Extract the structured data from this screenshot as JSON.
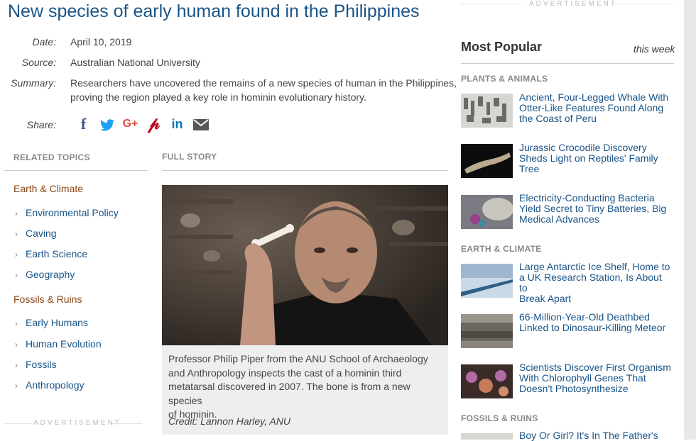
{
  "article": {
    "title": "New species of early human found in the Philippines",
    "date_label": "Date:",
    "date": "April 10, 2019",
    "source_label": "Source:",
    "source": "Australian National University",
    "summary_label": "Summary:",
    "summary_line1": "Researchers have uncovered the remains of a new species of human in the Philippines,",
    "summary_line2": "proving the region played a key role in hominin evolutionary history.",
    "share_label": "Share:",
    "share_icons": [
      "facebook-icon",
      "twitter-icon",
      "google-plus-icon",
      "pinterest-icon",
      "linkedin-icon",
      "email-icon"
    ],
    "full_story": "FULL STORY",
    "caption_lines": [
      "Professor Philip Piper from the ANU School of Archaeology",
      "and Anthropology inspects the cast of a hominin third",
      "metatarsal discovered in 2007. The bone is from a new species",
      "of hominin."
    ],
    "credit": "Credit: Lannon Harley, ANU"
  },
  "related": {
    "heading": "RELATED TOPICS",
    "groups": [
      {
        "name": "Earth & Climate",
        "items": [
          "Environmental Policy",
          "Caving",
          "Earth Science",
          "Geography"
        ]
      },
      {
        "name": "Fossils & Ruins",
        "items": [
          "Early Humans",
          "Human Evolution",
          "Fossils",
          "Anthropology"
        ]
      }
    ]
  },
  "ads": {
    "label": "ADVERTISEMENT"
  },
  "sidebar": {
    "title": "Most Popular",
    "period": "this week",
    "sections": [
      {
        "category": "PLANTS & ANIMALS",
        "items": [
          [
            "Ancient, Four-Legged Whale With",
            "Otter-Like Features Found Along",
            "the Coast of Peru"
          ],
          [
            "Jurassic Crocodile Discovery",
            "Sheds Light on Reptiles' Family",
            "Tree"
          ],
          [
            "Electricity-Conducting Bacteria",
            "Yield Secret to Tiny Batteries, Big",
            "Medical Advances"
          ]
        ]
      },
      {
        "category": "EARTH & CLIMATE",
        "items": [
          [
            "Large Antarctic Ice Shelf, Home to",
            "a UK Research Station, Is About to",
            "Break Apart"
          ],
          [
            "66-Million-Year-Old Deathbed",
            "Linked to Dinosaur-Killing Meteor"
          ],
          [
            "Scientists Discover First Organism",
            "With Chlorophyll Genes That",
            "Doesn't Photosynthesize"
          ]
        ]
      },
      {
        "category": "FOSSILS & RUINS",
        "items": [
          [
            "Boy Or Girl? It's In The Father's"
          ]
        ]
      }
    ]
  },
  "colors": {
    "link": "#1a5487",
    "category": "#8b4513",
    "facebook": "#3b5998",
    "twitter": "#1da1f2",
    "google": "#dd4b39",
    "pinterest": "#bd081c",
    "linkedin": "#0077b5",
    "email": "#555555"
  }
}
